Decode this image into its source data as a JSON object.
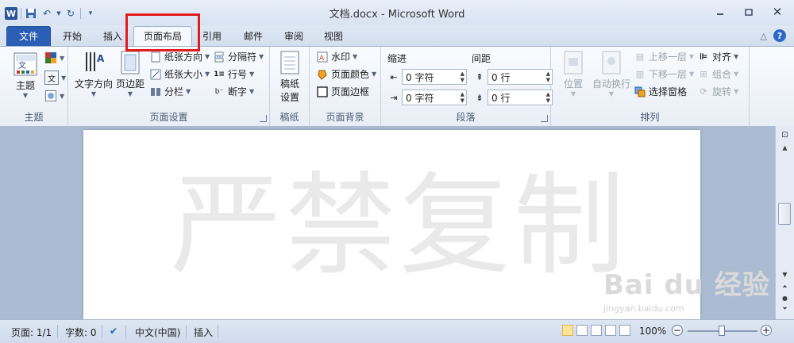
{
  "title_bar": {
    "doc_title": "文档.docx - Microsoft Word",
    "app_icon": "W",
    "quick_access": [
      "save-icon",
      "undo-icon",
      "redo-icon",
      "customize-icon"
    ]
  },
  "tabs": [
    {
      "label": "文件",
      "type": "file"
    },
    {
      "label": "开始"
    },
    {
      "label": "插入"
    },
    {
      "label": "页面布局",
      "active": true
    },
    {
      "label": "引用"
    },
    {
      "label": "邮件"
    },
    {
      "label": "审阅"
    },
    {
      "label": "视图"
    }
  ],
  "ribbon": {
    "theme": {
      "label": "主题",
      "btn": "主题"
    },
    "page_setup": {
      "label": "页面设置",
      "text_direction": "文字方向",
      "margins": "页边距",
      "orientation": "纸张方向",
      "size": "纸张大小",
      "columns": "分栏",
      "breaks": "分隔符",
      "line_numbers": "行号",
      "hyphenation": "断字"
    },
    "draft_paper": {
      "label": "稿纸",
      "btn_line1": "稿纸",
      "btn_line2": "设置"
    },
    "page_background": {
      "label": "页面背景",
      "watermark": "水印",
      "page_color": "页面颜色",
      "page_borders": "页面边框"
    },
    "paragraph": {
      "label": "段落",
      "indent_heading": "缩进",
      "spacing_heading": "间距",
      "left_indent": "0 字符",
      "right_indent": "0 字符",
      "before_spacing": "0 行",
      "after_spacing": "0 行"
    },
    "arrange": {
      "label": "排列",
      "position": "位置",
      "wrap_text": "自动换行",
      "bring_forward": "上移一层",
      "send_backward": "下移一层",
      "selection_pane": "选择窗格",
      "align": "对齐",
      "group": "组合",
      "rotate": "旋转"
    }
  },
  "document": {
    "watermark_text": "严禁复制",
    "site_watermark": "Bai du 经验",
    "site_watermark_sub": "jingyan.baidu.com"
  },
  "status_bar": {
    "page": "页面: 1/1",
    "words": "字数: 0",
    "language": "中文(中国)",
    "mode": "插入",
    "zoom": "100%"
  },
  "colors": {
    "file_tab": "#2b5fb5",
    "highlight": "#e31b1b"
  }
}
